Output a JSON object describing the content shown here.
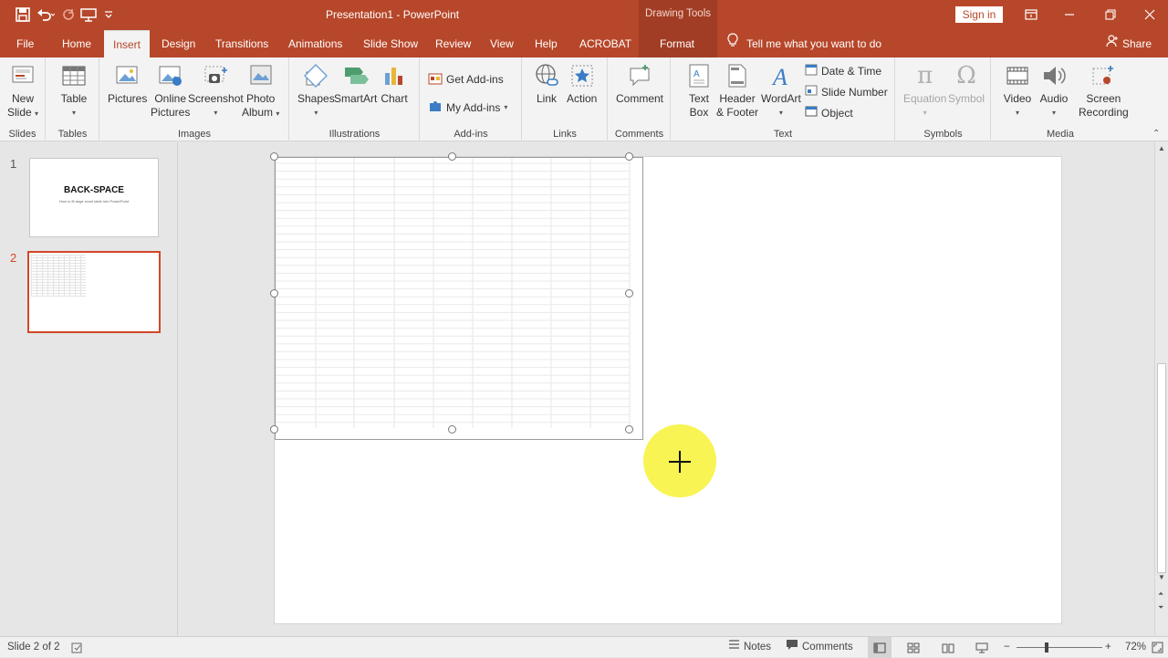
{
  "window": {
    "title": "Presentation1  -  PowerPoint",
    "context_tab_group": "Drawing Tools",
    "sign_in": "Sign in",
    "accent": "#b7472a"
  },
  "tabs": [
    {
      "label": "File"
    },
    {
      "label": "Home"
    },
    {
      "label": "Insert"
    },
    {
      "label": "Design"
    },
    {
      "label": "Transitions"
    },
    {
      "label": "Animations"
    },
    {
      "label": "Slide Show"
    },
    {
      "label": "Review"
    },
    {
      "label": "View"
    },
    {
      "label": "Help"
    },
    {
      "label": "ACROBAT"
    },
    {
      "label": "Format"
    }
  ],
  "active_tab": "Insert",
  "tell_me": "Tell me what you want to do",
  "share": "Share",
  "ribbon": {
    "slides": {
      "label": "Slides",
      "new_slide_1": "New",
      "new_slide_2": "Slide"
    },
    "tables": {
      "label": "Tables",
      "table": "Table"
    },
    "images": {
      "label": "Images",
      "pictures": "Pictures",
      "online_1": "Online",
      "online_2": "Pictures",
      "screenshot": "Screenshot",
      "album_1": "Photo",
      "album_2": "Album"
    },
    "illustrations": {
      "label": "Illustrations",
      "shapes": "Shapes",
      "smartart": "SmartArt",
      "chart": "Chart"
    },
    "addins": {
      "label": "Add-ins",
      "get": "Get Add-ins",
      "my": "My Add-ins"
    },
    "links": {
      "label": "Links",
      "link": "Link",
      "action": "Action"
    },
    "comments": {
      "label": "Comments",
      "comment": "Comment"
    },
    "text": {
      "label": "Text",
      "textbox_1": "Text",
      "textbox_2": "Box",
      "header_1": "Header",
      "header_2": "& Footer",
      "wordart": "WordArt",
      "date_time": "Date & Time",
      "slide_number": "Slide Number",
      "object": "Object"
    },
    "symbols": {
      "label": "Symbols",
      "equation": "Equation",
      "symbol": "Symbol"
    },
    "media": {
      "label": "Media",
      "video": "Video",
      "audio": "Audio",
      "rec_1": "Screen",
      "rec_2": "Recording"
    }
  },
  "thumbnails": [
    {
      "number": "1",
      "title": "BACK-SPACE",
      "subtitle": "How to fit large excel table into PowerPoint"
    },
    {
      "number": "2"
    }
  ],
  "status": {
    "slide_info": "Slide 2 of 2",
    "notes": "Notes",
    "comments": "Comments",
    "zoom": "72%",
    "minus": "−",
    "plus": "+"
  }
}
